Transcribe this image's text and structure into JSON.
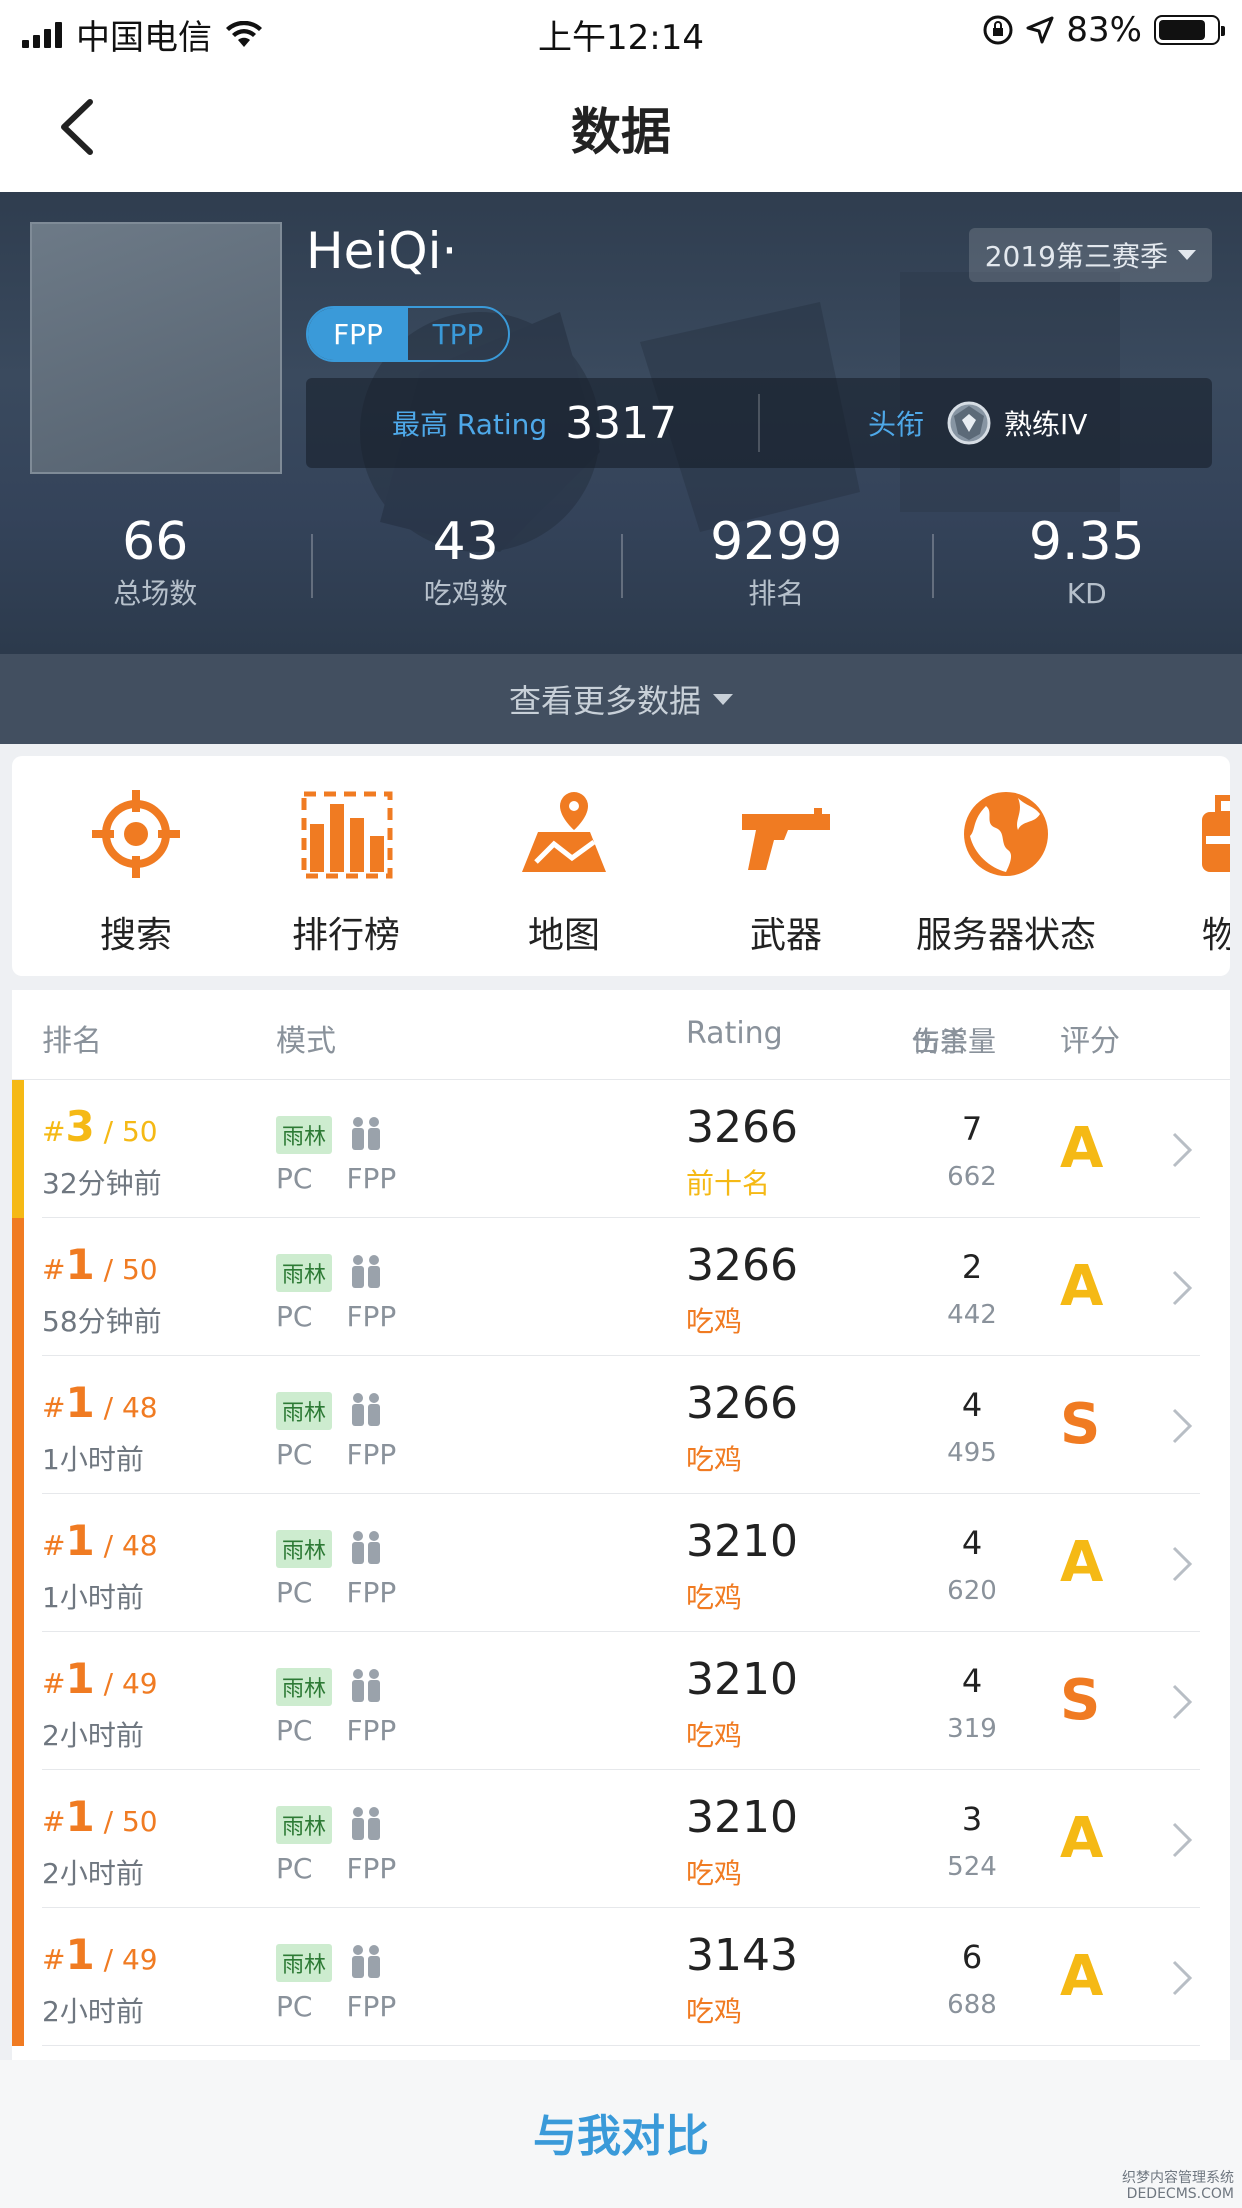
{
  "status_bar": {
    "carrier": "中国电信",
    "time": "上午12:14",
    "battery": "83%",
    "battery_level": 0.83
  },
  "nav": {
    "title": "数据"
  },
  "player": {
    "name": "HeiQi·",
    "season": "2019第三赛季",
    "modes": [
      "FPP",
      "TPP"
    ],
    "active_mode": "FPP",
    "rating_label": "最高 Rating",
    "rating_value": "3317",
    "title_label": "头衔",
    "title_value": "熟练IV"
  },
  "stats": [
    {
      "value": "66",
      "label": "总场数"
    },
    {
      "value": "43",
      "label": "吃鸡数"
    },
    {
      "value": "9299",
      "label": "排名"
    },
    {
      "value": "9.35",
      "label": "KD"
    }
  ],
  "more_data": "查看更多数据",
  "tools": [
    {
      "label": "搜索",
      "icon": "crosshair-icon"
    },
    {
      "label": "排行榜",
      "icon": "leaderboard-icon"
    },
    {
      "label": "地图",
      "icon": "map-icon"
    },
    {
      "label": "武器",
      "icon": "pistol-icon"
    },
    {
      "label": "服务器状态",
      "icon": "globe-icon"
    },
    {
      "label": "物",
      "icon": "item-icon"
    }
  ],
  "table": {
    "headers": {
      "rank": "排名",
      "mode": "模式",
      "rating": "Rating",
      "kills": "击杀",
      "damage": "伤害量",
      "grade": "评分"
    },
    "rows": [
      {
        "rank": "3",
        "total": "/ 50",
        "time": "32分钟前",
        "map": "雨林",
        "platform": "PC",
        "mode": "FPP",
        "rating": "3266",
        "result": "前十名",
        "kills": "7",
        "damage": "662",
        "grade": "A"
      },
      {
        "rank": "1",
        "total": "/ 50",
        "time": "58分钟前",
        "map": "雨林",
        "platform": "PC",
        "mode": "FPP",
        "rating": "3266",
        "result": "吃鸡",
        "kills": "2",
        "damage": "442",
        "grade": "A"
      },
      {
        "rank": "1",
        "total": "/ 48",
        "time": "1小时前",
        "map": "雨林",
        "platform": "PC",
        "mode": "FPP",
        "rating": "3266",
        "result": "吃鸡",
        "kills": "4",
        "damage": "495",
        "grade": "S"
      },
      {
        "rank": "1",
        "total": "/ 48",
        "time": "1小时前",
        "map": "雨林",
        "platform": "PC",
        "mode": "FPP",
        "rating": "3210",
        "result": "吃鸡",
        "kills": "4",
        "damage": "620",
        "grade": "A"
      },
      {
        "rank": "1",
        "total": "/ 49",
        "time": "2小时前",
        "map": "雨林",
        "platform": "PC",
        "mode": "FPP",
        "rating": "3210",
        "result": "吃鸡",
        "kills": "4",
        "damage": "319",
        "grade": "S"
      },
      {
        "rank": "1",
        "total": "/ 50",
        "time": "2小时前",
        "map": "雨林",
        "platform": "PC",
        "mode": "FPP",
        "rating": "3210",
        "result": "吃鸡",
        "kills": "3",
        "damage": "524",
        "grade": "A"
      },
      {
        "rank": "1",
        "total": "/ 49",
        "time": "2小时前",
        "map": "雨林",
        "platform": "PC",
        "mode": "FPP",
        "rating": "3143",
        "result": "吃鸡",
        "kills": "6",
        "damage": "688",
        "grade": "A"
      }
    ]
  },
  "compare_button": "与我对比",
  "watermark": [
    "织梦内容管理系统",
    "DEDECMS.COM"
  ],
  "colors": {
    "accent_blue": "#3a9ad9",
    "orange": "#f07b22",
    "gold": "#f5b915"
  }
}
